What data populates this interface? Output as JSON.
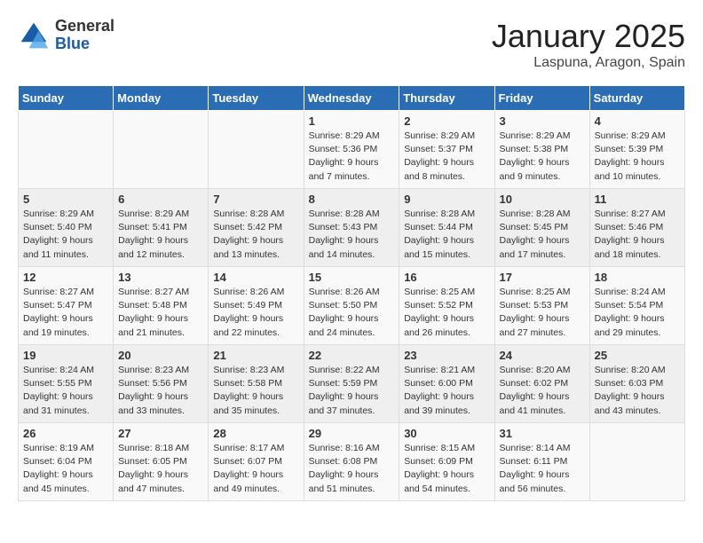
{
  "header": {
    "logo_general": "General",
    "logo_blue": "Blue",
    "month_title": "January 2025",
    "location": "Laspuna, Aragon, Spain"
  },
  "days_of_week": [
    "Sunday",
    "Monday",
    "Tuesday",
    "Wednesday",
    "Thursday",
    "Friday",
    "Saturday"
  ],
  "weeks": [
    [
      {
        "day": "",
        "info": ""
      },
      {
        "day": "",
        "info": ""
      },
      {
        "day": "",
        "info": ""
      },
      {
        "day": "1",
        "info": "Sunrise: 8:29 AM\nSunset: 5:36 PM\nDaylight: 9 hours\nand 7 minutes."
      },
      {
        "day": "2",
        "info": "Sunrise: 8:29 AM\nSunset: 5:37 PM\nDaylight: 9 hours\nand 8 minutes."
      },
      {
        "day": "3",
        "info": "Sunrise: 8:29 AM\nSunset: 5:38 PM\nDaylight: 9 hours\nand 9 minutes."
      },
      {
        "day": "4",
        "info": "Sunrise: 8:29 AM\nSunset: 5:39 PM\nDaylight: 9 hours\nand 10 minutes."
      }
    ],
    [
      {
        "day": "5",
        "info": "Sunrise: 8:29 AM\nSunset: 5:40 PM\nDaylight: 9 hours\nand 11 minutes."
      },
      {
        "day": "6",
        "info": "Sunrise: 8:29 AM\nSunset: 5:41 PM\nDaylight: 9 hours\nand 12 minutes."
      },
      {
        "day": "7",
        "info": "Sunrise: 8:28 AM\nSunset: 5:42 PM\nDaylight: 9 hours\nand 13 minutes."
      },
      {
        "day": "8",
        "info": "Sunrise: 8:28 AM\nSunset: 5:43 PM\nDaylight: 9 hours\nand 14 minutes."
      },
      {
        "day": "9",
        "info": "Sunrise: 8:28 AM\nSunset: 5:44 PM\nDaylight: 9 hours\nand 15 minutes."
      },
      {
        "day": "10",
        "info": "Sunrise: 8:28 AM\nSunset: 5:45 PM\nDaylight: 9 hours\nand 17 minutes."
      },
      {
        "day": "11",
        "info": "Sunrise: 8:27 AM\nSunset: 5:46 PM\nDaylight: 9 hours\nand 18 minutes."
      }
    ],
    [
      {
        "day": "12",
        "info": "Sunrise: 8:27 AM\nSunset: 5:47 PM\nDaylight: 9 hours\nand 19 minutes."
      },
      {
        "day": "13",
        "info": "Sunrise: 8:27 AM\nSunset: 5:48 PM\nDaylight: 9 hours\nand 21 minutes."
      },
      {
        "day": "14",
        "info": "Sunrise: 8:26 AM\nSunset: 5:49 PM\nDaylight: 9 hours\nand 22 minutes."
      },
      {
        "day": "15",
        "info": "Sunrise: 8:26 AM\nSunset: 5:50 PM\nDaylight: 9 hours\nand 24 minutes."
      },
      {
        "day": "16",
        "info": "Sunrise: 8:25 AM\nSunset: 5:52 PM\nDaylight: 9 hours\nand 26 minutes."
      },
      {
        "day": "17",
        "info": "Sunrise: 8:25 AM\nSunset: 5:53 PM\nDaylight: 9 hours\nand 27 minutes."
      },
      {
        "day": "18",
        "info": "Sunrise: 8:24 AM\nSunset: 5:54 PM\nDaylight: 9 hours\nand 29 minutes."
      }
    ],
    [
      {
        "day": "19",
        "info": "Sunrise: 8:24 AM\nSunset: 5:55 PM\nDaylight: 9 hours\nand 31 minutes."
      },
      {
        "day": "20",
        "info": "Sunrise: 8:23 AM\nSunset: 5:56 PM\nDaylight: 9 hours\nand 33 minutes."
      },
      {
        "day": "21",
        "info": "Sunrise: 8:23 AM\nSunset: 5:58 PM\nDaylight: 9 hours\nand 35 minutes."
      },
      {
        "day": "22",
        "info": "Sunrise: 8:22 AM\nSunset: 5:59 PM\nDaylight: 9 hours\nand 37 minutes."
      },
      {
        "day": "23",
        "info": "Sunrise: 8:21 AM\nSunset: 6:00 PM\nDaylight: 9 hours\nand 39 minutes."
      },
      {
        "day": "24",
        "info": "Sunrise: 8:20 AM\nSunset: 6:02 PM\nDaylight: 9 hours\nand 41 minutes."
      },
      {
        "day": "25",
        "info": "Sunrise: 8:20 AM\nSunset: 6:03 PM\nDaylight: 9 hours\nand 43 minutes."
      }
    ],
    [
      {
        "day": "26",
        "info": "Sunrise: 8:19 AM\nSunset: 6:04 PM\nDaylight: 9 hours\nand 45 minutes."
      },
      {
        "day": "27",
        "info": "Sunrise: 8:18 AM\nSunset: 6:05 PM\nDaylight: 9 hours\nand 47 minutes."
      },
      {
        "day": "28",
        "info": "Sunrise: 8:17 AM\nSunset: 6:07 PM\nDaylight: 9 hours\nand 49 minutes."
      },
      {
        "day": "29",
        "info": "Sunrise: 8:16 AM\nSunset: 6:08 PM\nDaylight: 9 hours\nand 51 minutes."
      },
      {
        "day": "30",
        "info": "Sunrise: 8:15 AM\nSunset: 6:09 PM\nDaylight: 9 hours\nand 54 minutes."
      },
      {
        "day": "31",
        "info": "Sunrise: 8:14 AM\nSunset: 6:11 PM\nDaylight: 9 hours\nand 56 minutes."
      },
      {
        "day": "",
        "info": ""
      }
    ]
  ]
}
